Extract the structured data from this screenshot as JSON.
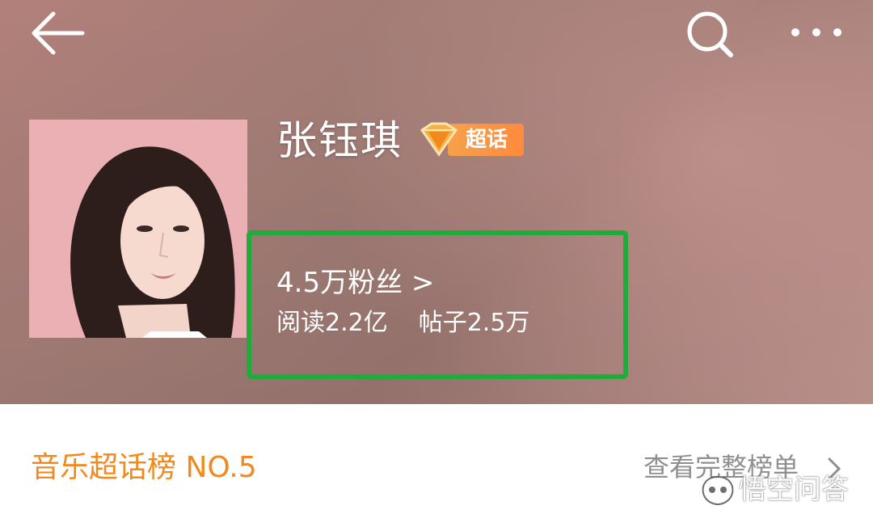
{
  "topbar": {
    "back_icon": "arrow-left-icon",
    "search_icon": "search-icon",
    "more_icon": "more-dots-icon"
  },
  "profile": {
    "name": "张钰琪",
    "badge_label": "超话",
    "badge_icon": "diamond-icon",
    "stats": {
      "fans": "4.5万粉丝 >",
      "reads": "阅读2.2亿",
      "posts": "帖子2.5万"
    }
  },
  "ranking": {
    "title": "音乐超话榜 NO.5",
    "link_label": "查看完整榜单",
    "chevron_icon": "chevron-right-icon"
  },
  "watermark": {
    "text": "悟空问答",
    "icon": "wukong-logo-icon"
  },
  "colors": {
    "highlight_box": "#1fac3a",
    "rank_title": "#f08a1f",
    "badge": "#ff8a3d"
  }
}
